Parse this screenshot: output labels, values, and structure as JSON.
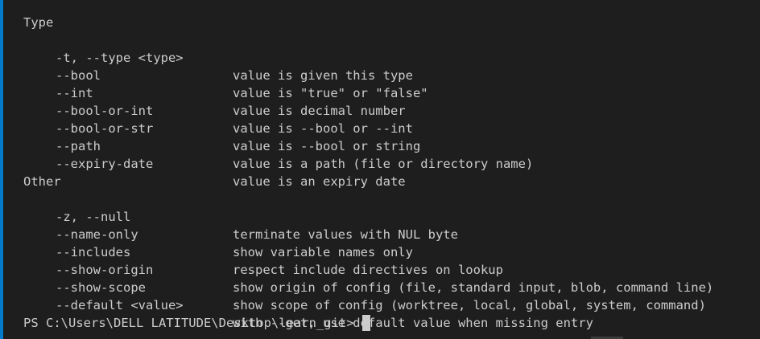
{
  "sections": [
    {
      "heading": "Type",
      "rows": [
        {
          "opt": "-t, --type <type>",
          "desc": "value is given this type"
        },
        {
          "opt": "--bool",
          "desc": "value is \"true\" or \"false\""
        },
        {
          "opt": "--int",
          "desc": "value is decimal number"
        },
        {
          "opt": "--bool-or-int",
          "desc": "value is --bool or --int"
        },
        {
          "opt": "--bool-or-str",
          "desc": "value is --bool or string"
        },
        {
          "opt": "--path",
          "desc": "value is a path (file or directory name)"
        },
        {
          "opt": "--expiry-date",
          "desc": "value is an expiry date"
        }
      ]
    },
    {
      "heading": "Other",
      "rows": [
        {
          "opt": "-z, --null",
          "desc": "terminate values with NUL byte"
        },
        {
          "opt": "--name-only",
          "desc": "show variable names only"
        },
        {
          "opt": "--includes",
          "desc": "respect include directives on lookup"
        },
        {
          "opt": "--show-origin",
          "desc": "show origin of config (file, standard input, blob, command line)"
        },
        {
          "opt": "--show-scope",
          "desc": "show scope of config (worktree, local, global, system, command)"
        },
        {
          "opt": "--default <value>",
          "desc": "with --get, use default value when missing entry"
        }
      ]
    }
  ],
  "prompt": "PS C:\\Users\\DELL LATITUDE\\Desktop\\learn_git>",
  "colors": {
    "background": "#1e1e1e",
    "text": "#cccccc",
    "accent": "#007acc"
  }
}
